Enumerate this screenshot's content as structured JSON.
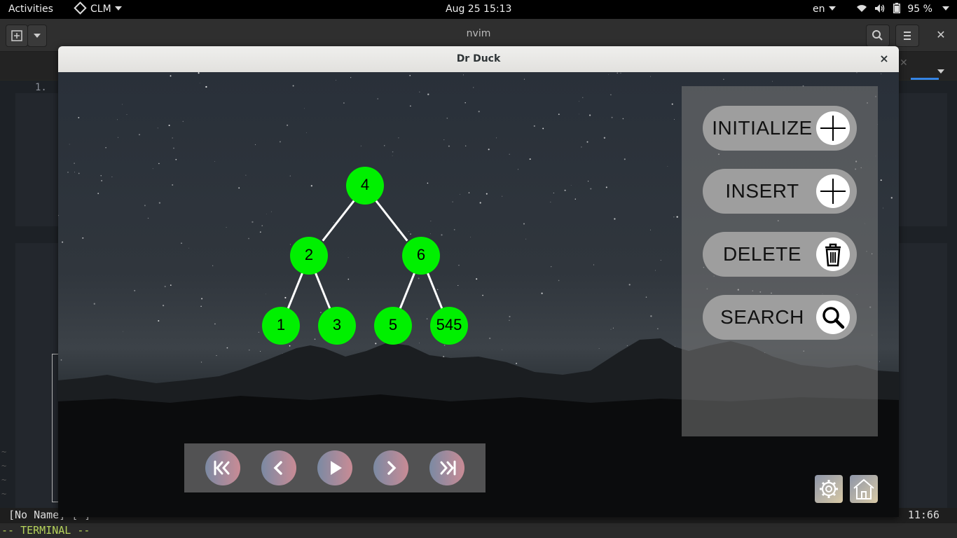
{
  "topbar": {
    "activities": "Activities",
    "app_name": "CLM",
    "clock": "Aug 25  15:13",
    "language": "en",
    "battery": "95 %"
  },
  "terminal": {
    "title": "nvim",
    "line_number": "1.",
    "status_left": "[No Name] [-]",
    "status_right": "11:66",
    "mode": "-- TERMINAL --"
  },
  "app": {
    "window_title": "Dr Duck",
    "close_glyph": "×",
    "tree": {
      "nodes": [
        "4",
        "2",
        "6",
        "1",
        "3",
        "5",
        "545"
      ],
      "edges": [
        [
          "4",
          "2"
        ],
        [
          "4",
          "6"
        ],
        [
          "2",
          "1"
        ],
        [
          "2",
          "3"
        ],
        [
          "6",
          "5"
        ],
        [
          "6",
          "545"
        ]
      ],
      "node_color": "#00f000"
    },
    "actions": [
      {
        "label": "INITIALIZE",
        "icon": "plus-icon"
      },
      {
        "label": "INSERT",
        "icon": "plus-icon"
      },
      {
        "label": "DELETE",
        "icon": "trash-icon"
      },
      {
        "label": "SEARCH",
        "icon": "search-icon"
      }
    ],
    "playback": [
      "skip-to-start-icon",
      "step-back-icon",
      "play-icon",
      "step-forward-icon",
      "skip-to-end-icon"
    ],
    "corner": [
      "settings-gear-icon",
      "home-icon"
    ]
  }
}
